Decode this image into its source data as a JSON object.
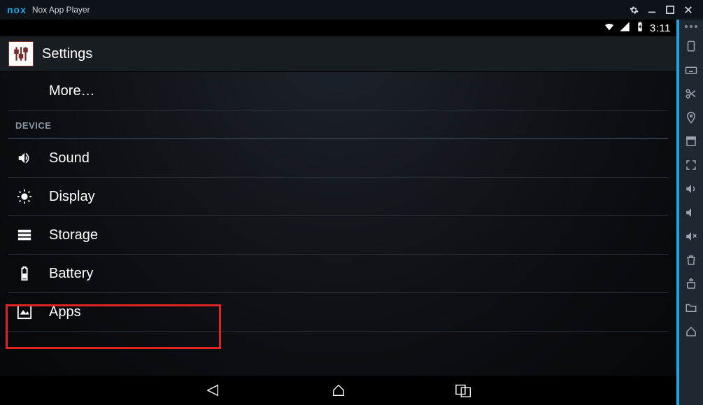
{
  "titlebar": {
    "app_name": "Nox App Player",
    "logo_text": "nox"
  },
  "window_controls": {
    "settings_icon": "gear-icon",
    "minimize_icon": "minimize-icon",
    "maximize_icon": "maximize-icon",
    "close_icon": "close-icon"
  },
  "android_status": {
    "wifi_icon": "wifi-icon",
    "signal_icon": "signal-icon",
    "battery_icon": "battery-charging-icon",
    "time": "3:11"
  },
  "settings": {
    "title": "Settings",
    "top_item": "More…",
    "section_header": "DEVICE",
    "items": [
      {
        "icon": "sound-icon",
        "label": "Sound"
      },
      {
        "icon": "display-icon",
        "label": "Display"
      },
      {
        "icon": "storage-icon",
        "label": "Storage"
      },
      {
        "icon": "battery-icon",
        "label": "Battery"
      },
      {
        "icon": "apps-icon",
        "label": "Apps"
      }
    ]
  },
  "android_nav": {
    "back_icon": "back-icon",
    "home_icon": "home-icon",
    "recent_icon": "recent-apps-icon"
  },
  "nox_sidebar": {
    "items": [
      "more-icon",
      "rotate-icon",
      "keyboard-icon",
      "scissors-icon",
      "location-icon",
      "single-window-icon",
      "fullscreen-icon",
      "volume-up-icon",
      "volume-down-icon",
      "mute-icon",
      "trash-icon",
      "apk-install-icon",
      "folder-icon",
      "home-emu-icon"
    ]
  },
  "colors": {
    "accent": "#1fa3e2",
    "highlight": "#e02424",
    "window_bg": "#0e131a",
    "sidebar_bg": "#1f2730"
  }
}
